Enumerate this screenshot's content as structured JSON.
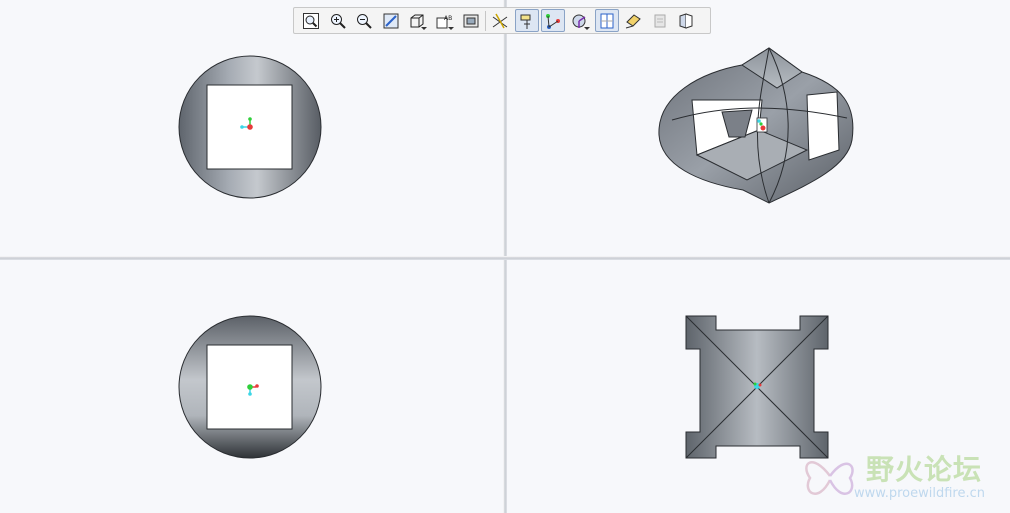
{
  "toolbar": {
    "buttons": [
      {
        "icon": "zoom-fit-icon",
        "active": false
      },
      {
        "icon": "zoom-in-icon",
        "active": false
      },
      {
        "icon": "zoom-out-icon",
        "active": false
      },
      {
        "icon": "repaint-icon",
        "active": false
      },
      {
        "icon": "display-style-icon",
        "active": false,
        "dropdown": true
      },
      {
        "icon": "annotation-display-icon",
        "active": false,
        "dropdown": true
      },
      {
        "icon": "view-manager-icon",
        "active": false
      },
      {
        "icon": "datum-planes-icon",
        "active": false
      },
      {
        "icon": "datum-axes-icon",
        "active": true
      },
      {
        "icon": "datum-points-icon",
        "active": true
      },
      {
        "icon": "coordinate-systems-icon",
        "active": false,
        "dropdown": true
      },
      {
        "icon": "spin-center-icon",
        "active": true
      },
      {
        "icon": "sketch-view-icon",
        "active": false
      },
      {
        "icon": "layer-icon",
        "active": false
      },
      {
        "icon": "section-icon",
        "active": false
      }
    ]
  },
  "watermark": {
    "title": "野火论坛",
    "url": "www.proewildfire.cn"
  },
  "colors": {
    "model_gray": "#7d838b",
    "background": "#f7f8fb",
    "axis_red": "#e83a3a",
    "axis_green": "#2fcf3a",
    "axis_cyan": "#3bd6e6"
  }
}
